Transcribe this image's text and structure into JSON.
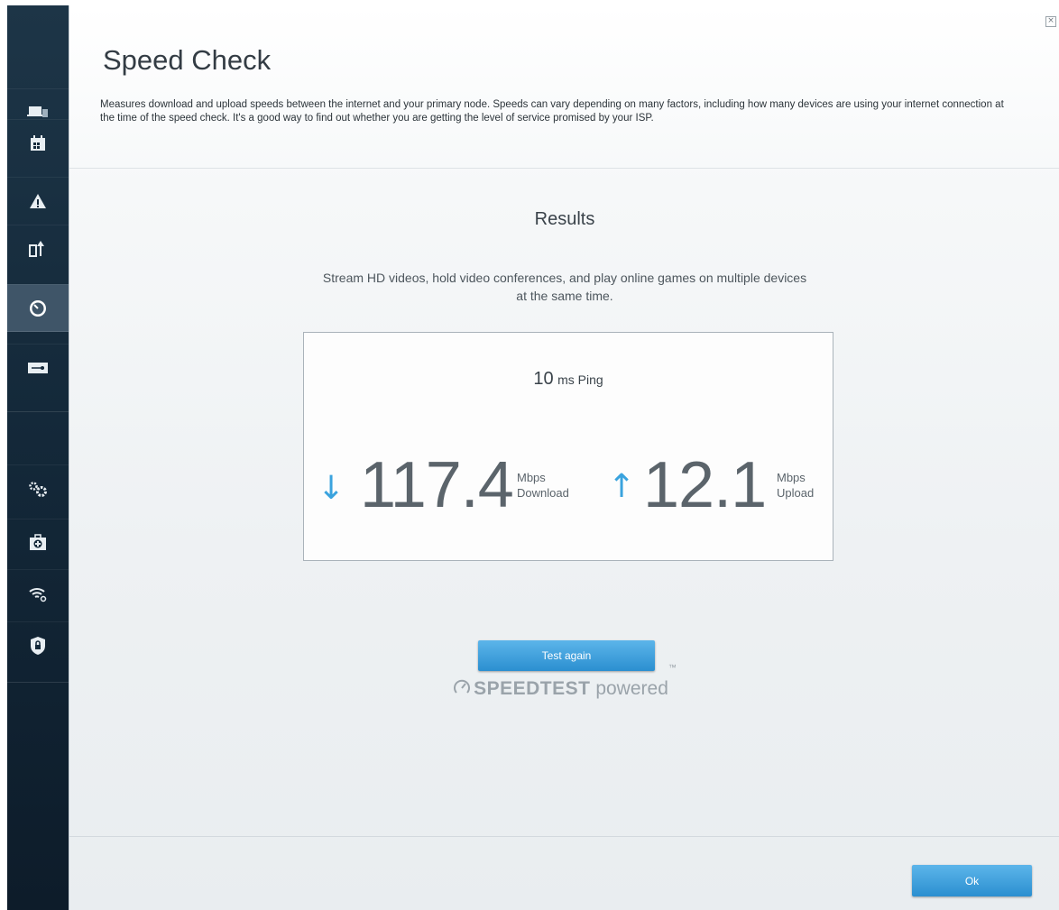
{
  "page": {
    "title": "Speed Check",
    "description": "Measures download and upload speeds between the internet and your primary node. Speeds can vary depending on many factors, including how many devices are using your internet connection at the time of the speed check. It's a good way to find out whether you are getting the level of service promised by your ISP.",
    "close_icon": "close-icon"
  },
  "sidebar": {
    "items": [
      {
        "name": "devices",
        "icon": "devices-icon"
      },
      {
        "name": "parental-controls",
        "icon": "calendar-icon"
      },
      {
        "name": "alerts",
        "icon": "warning-icon"
      },
      {
        "name": "updates",
        "icon": "update-icon"
      },
      {
        "name": "speed-check",
        "icon": "speedometer-icon",
        "active": true
      },
      {
        "name": "usb",
        "icon": "usb-icon"
      },
      {
        "name": "advanced-settings",
        "icon": "gears-icon"
      },
      {
        "name": "diagnostics",
        "icon": "medkit-icon"
      },
      {
        "name": "wifi-settings",
        "icon": "wifi-icon"
      },
      {
        "name": "security",
        "icon": "shield-lock-icon"
      }
    ]
  },
  "results": {
    "title": "Results",
    "description": "Stream HD videos, hold video conferences, and play online games on multiple devices at the same time.",
    "ping_value": "10",
    "ping_unit": "ms Ping",
    "download_value": "117.4",
    "download_unit": "Mbps",
    "download_label": "Download",
    "upload_value": "12.1",
    "upload_unit": "Mbps",
    "upload_label": "Upload",
    "download_arrow": "↓",
    "upload_arrow": "↑"
  },
  "buttons": {
    "test_again": "Test again",
    "ok": "Ok"
  },
  "branding": {
    "speedtest": "SPEEDTEST",
    "powered": "powered",
    "tm": "™"
  },
  "colors": {
    "accent": "#2b8fd0",
    "arrow": "#3aa3de",
    "sidebar": "#14293a"
  }
}
